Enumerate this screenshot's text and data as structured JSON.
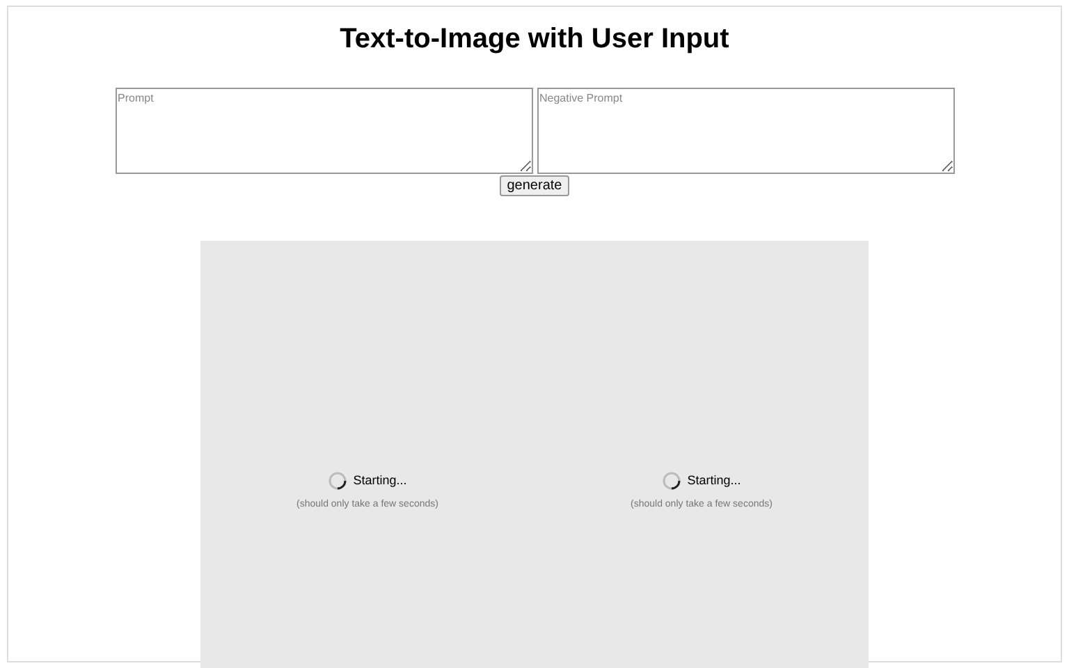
{
  "title": "Text-to-Image with User Input",
  "prompt": {
    "placeholder": "Prompt"
  },
  "negative_prompt": {
    "placeholder": "Negative Prompt"
  },
  "generate_button": "generate",
  "outputs": [
    {
      "status": "Starting...",
      "hint": "(should only take a few seconds)"
    },
    {
      "status": "Starting...",
      "hint": "(should only take a few seconds)"
    }
  ]
}
